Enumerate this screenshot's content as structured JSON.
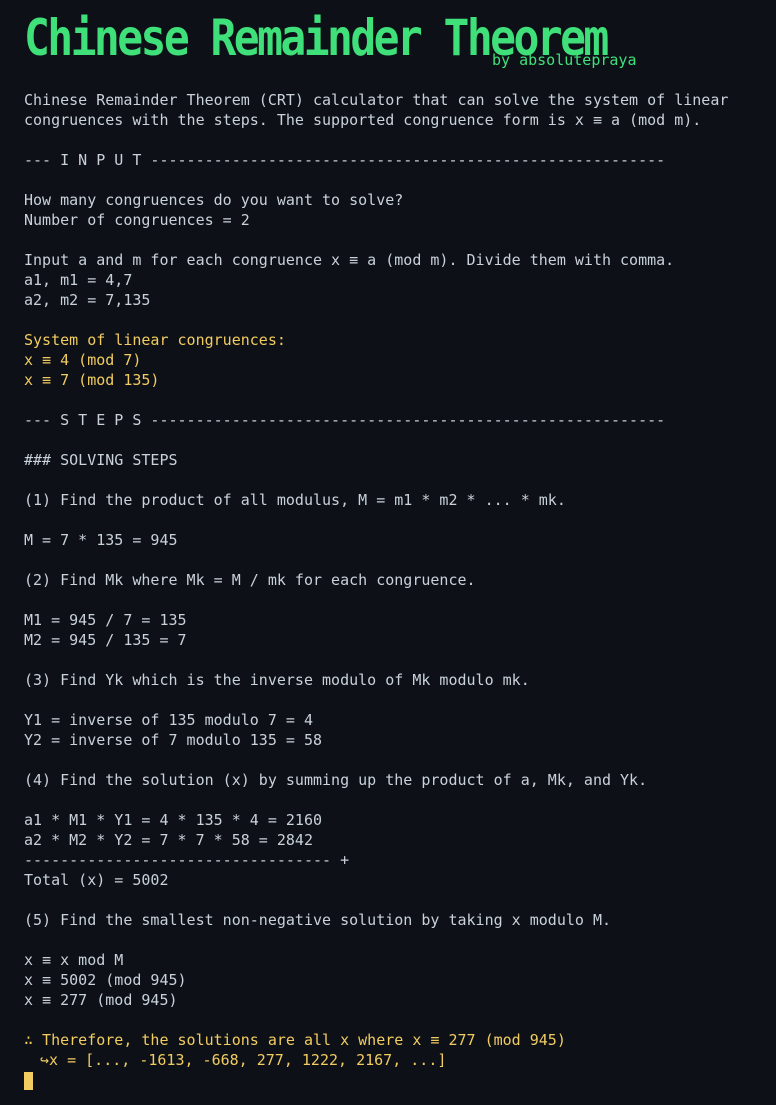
{
  "banner": {
    "title": "Chinese Remainder Theorem",
    "author": "by absolutepraya"
  },
  "intro": [
    "Chinese Remainder Theorem (CRT) calculator that can solve the system of linear",
    "congruences with the steps. The supported congruence form is x ≡ a (mod m)."
  ],
  "input_header": "--- I N P U T ---------------------------------------------------------",
  "prompt_count": "How many congruences do you want to solve?",
  "count_line": "Number of congruences = 2",
  "prompt_values": "Input a and m for each congruence x ≡ a (mod m). Divide them with comma.",
  "input_lines": [
    "a1, m1 = 4,7",
    "a2, m2 = 7,135"
  ],
  "system_title": "System of linear congruences:",
  "system_lines": [
    "x ≡ 4 (mod 7)",
    "x ≡ 7 (mod 135)"
  ],
  "steps_header": "--- S T E P S ---------------------------------------------------------",
  "solving_title": "### SOLVING STEPS",
  "step1": {
    "title": "(1) Find the product of all modulus, M = m1 * m2 * ... * mk.",
    "lines": [
      "M = 7 * 135 = 945"
    ]
  },
  "step2": {
    "title": "(2) Find Mk where Mk = M / mk for each congruence.",
    "lines": [
      "M1 = 945 / 7 = 135",
      "M2 = 945 / 135 = 7"
    ]
  },
  "step3": {
    "title": "(3) Find Yk which is the inverse modulo of Mk modulo mk.",
    "lines": [
      "Y1 = inverse of 135 modulo 7 = 4",
      "Y2 = inverse of 7 modulo 135 = 58"
    ]
  },
  "step4": {
    "title": "(4) Find the solution (x) by summing up the product of a, Mk, and Yk.",
    "lines": [
      "a1 * M1 * Y1 = 4 * 135 * 4 = 2160",
      "a2 * M2 * Y2 = 7 * 7 * 58 = 2842"
    ],
    "separator": "---------------------------------- +",
    "total": "Total (x) = 5002"
  },
  "step5": {
    "title": "(5) Find the smallest non-negative solution by taking x modulo M.",
    "lines": [
      "x ≡ x mod M",
      "x ≡ 5002 (mod 945)",
      "x ≡ 277 (mod 945)"
    ]
  },
  "conclusion": {
    "line": "∴ Therefore, the solutions are all x where x ≡ 277 (mod 945)",
    "list": "↪x = [..., -1613, -668, 277, 1222, 2167, ...]"
  },
  "colors": {
    "title_green": "#3fe07a",
    "highlight_yellow": "#f2cc60",
    "text": "#c9d1d9",
    "background": "#0d1117"
  }
}
